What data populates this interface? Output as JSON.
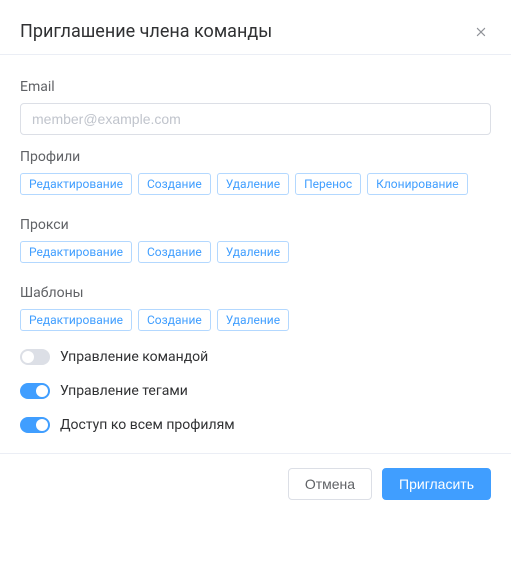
{
  "dialog": {
    "title": "Приглашение члена команды"
  },
  "email": {
    "label": "Email",
    "placeholder": "member@example.com",
    "value": ""
  },
  "permission_groups": [
    {
      "label": "Профили",
      "tags": [
        "Редактирование",
        "Создание",
        "Удаление",
        "Перенос",
        "Клонирование"
      ]
    },
    {
      "label": "Прокси",
      "tags": [
        "Редактирование",
        "Создание",
        "Удаление"
      ]
    },
    {
      "label": "Шаблоны",
      "tags": [
        "Редактирование",
        "Создание",
        "Удаление"
      ]
    }
  ],
  "switches": [
    {
      "label": "Управление командой",
      "on": false
    },
    {
      "label": "Управление тегами",
      "on": true
    },
    {
      "label": "Доступ ко всем профилям",
      "on": true
    }
  ],
  "footer": {
    "cancel": "Отмена",
    "submit": "Пригласить"
  },
  "colors": {
    "primary": "#409eff",
    "border": "#dcdfe6",
    "divider": "#ebeef5",
    "text": "#303133",
    "label": "#606266",
    "muted": "#909399"
  }
}
